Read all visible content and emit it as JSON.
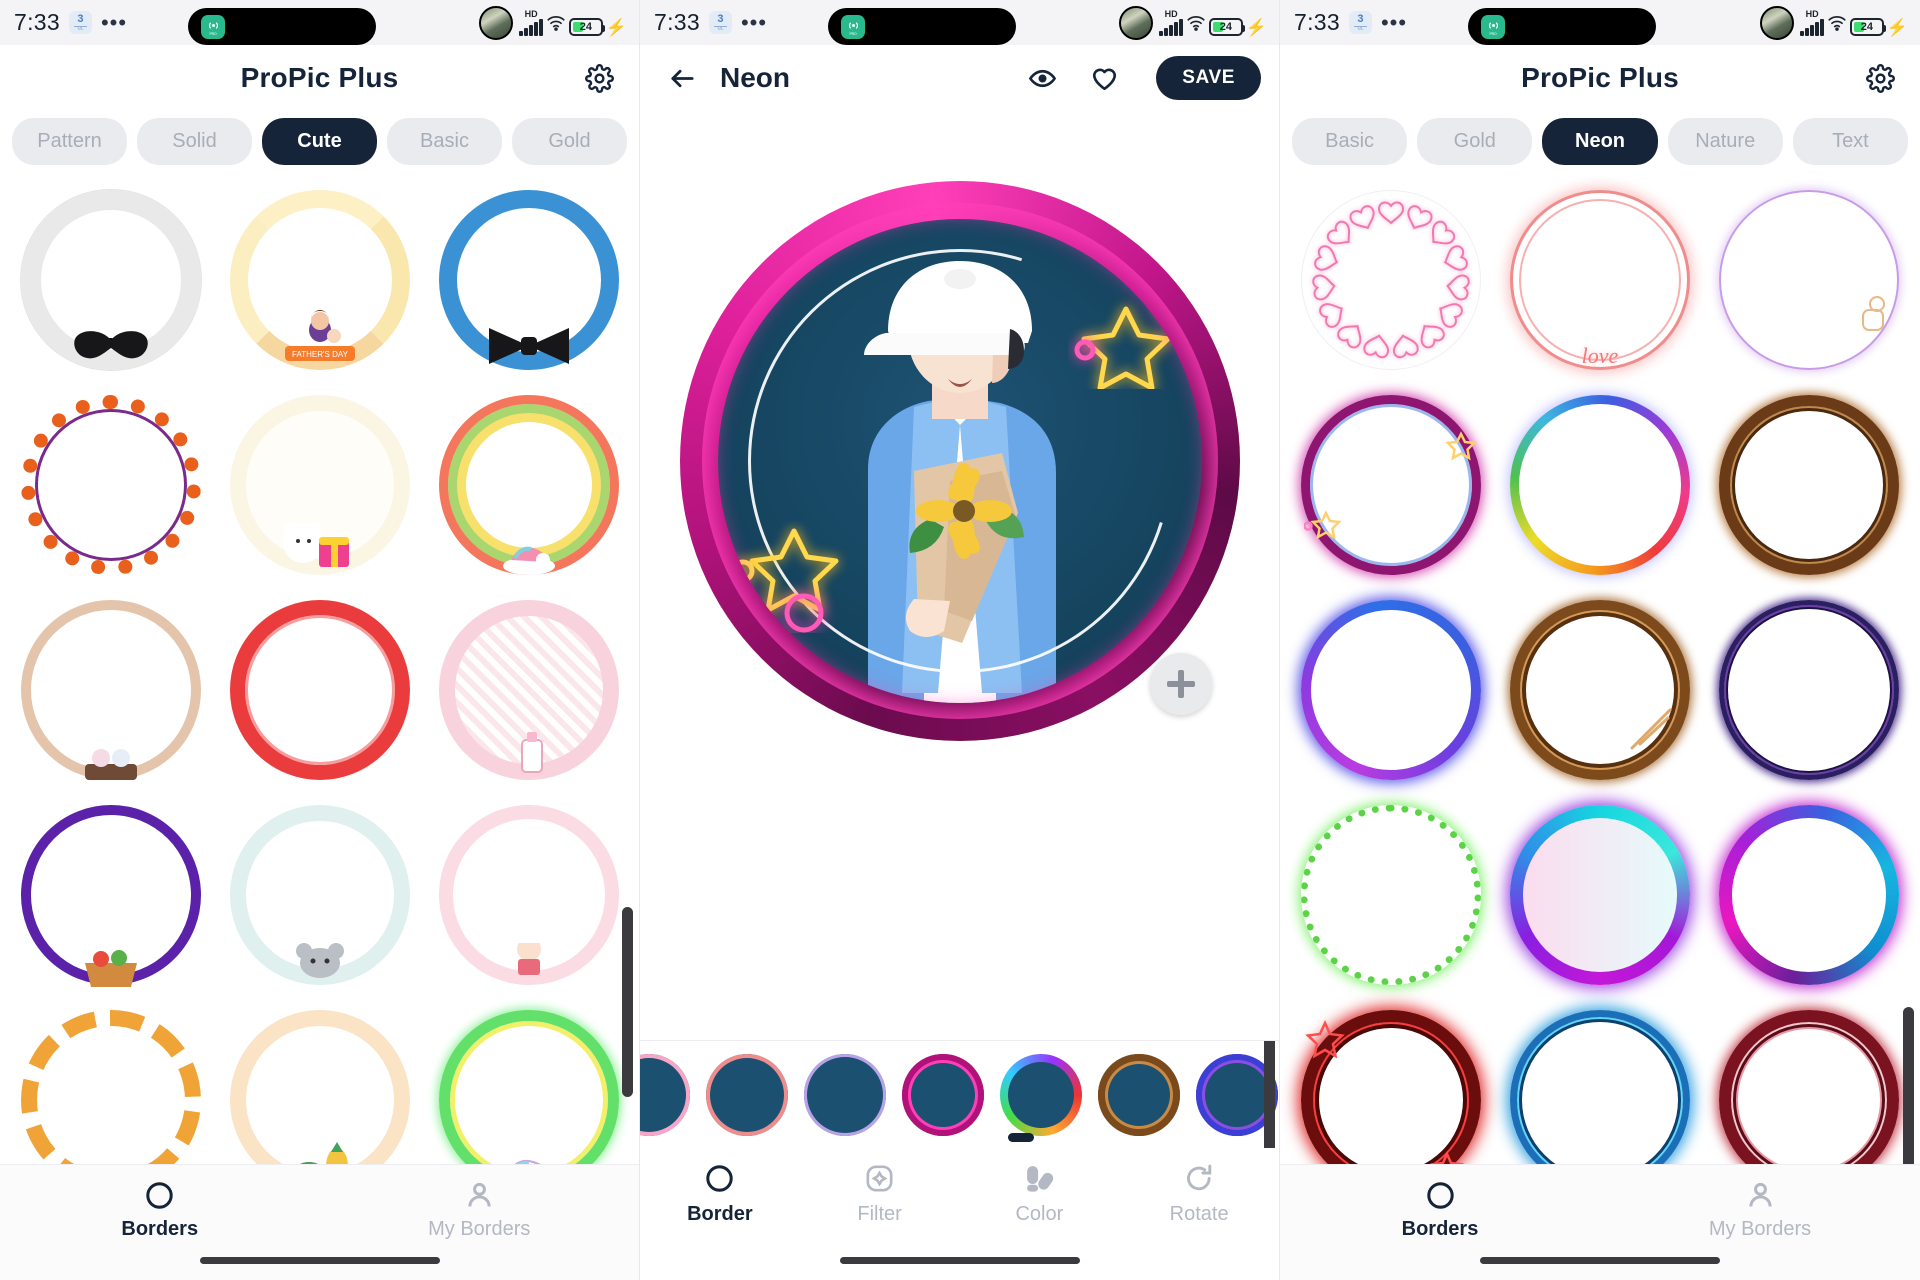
{
  "status_bar": {
    "time": "7:33",
    "chip_number": "3",
    "chip_sub": "ML",
    "overflow": "•••",
    "hd_label": "HD",
    "battery_percent": "24",
    "charging_icon": "charging-bolt-icon",
    "icons": [
      "recording-pill-icon",
      "avatar-icon",
      "hd-icon",
      "signal-icon",
      "wifi-icon",
      "battery-icon"
    ]
  },
  "panel1": {
    "header": {
      "title": "ProPic Plus",
      "settings_icon": "gear-icon"
    },
    "tabs": [
      {
        "label": "Pattern",
        "active": false
      },
      {
        "label": "Solid",
        "active": false
      },
      {
        "label": "Cute",
        "active": true
      },
      {
        "label": "Basic",
        "active": false
      },
      {
        "label": "Gold",
        "active": false
      }
    ],
    "borders": [
      {
        "name": "mustache-white-ruffle-border"
      },
      {
        "name": "fathers-day-cream-border"
      },
      {
        "name": "bowtie-blue-border"
      },
      {
        "name": "candy-orange-border"
      },
      {
        "name": "bear-gift-cream-border"
      },
      {
        "name": "unicorn-rainbow-border"
      },
      {
        "name": "teacup-beige-border"
      },
      {
        "name": "strawberry-red-border"
      },
      {
        "name": "pink-gingham-bottle-border"
      },
      {
        "name": "purple-picnic-basket-border"
      },
      {
        "name": "koala-mint-border"
      },
      {
        "name": "pink-chef-border"
      },
      {
        "name": "tiger-orange-border"
      },
      {
        "name": "watermelon-pineapple-border"
      },
      {
        "name": "unicorn-cloud-neon-border"
      }
    ],
    "bottom_nav": [
      {
        "label": "Borders",
        "icon": "circle-icon",
        "active": true
      },
      {
        "label": "My Borders",
        "icon": "person-icon",
        "active": false
      }
    ]
  },
  "panel2": {
    "header": {
      "back_icon": "back-arrow-icon",
      "title": "Neon",
      "preview_icon": "eye-icon",
      "favorite_icon": "heart-icon",
      "save_label": "SAVE"
    },
    "canvas": {
      "add_sticker_icon": "plus-icon",
      "border_name": "neon-magenta-ring",
      "subject": "person-with-sunflower-bouquet"
    },
    "thumbnails": [
      {
        "name": "thumb-heart-pink"
      },
      {
        "name": "thumb-coral-neon"
      },
      {
        "name": "thumb-lavender-thin"
      },
      {
        "name": "thumb-magenta-stars",
        "selected": true
      },
      {
        "name": "thumb-rainbow"
      },
      {
        "name": "thumb-brown-rope"
      },
      {
        "name": "thumb-blue-violet"
      }
    ],
    "toolbar": [
      {
        "label": "Border",
        "icon": "circle-icon",
        "active": true
      },
      {
        "label": "Filter",
        "icon": "filter-sparkle-icon",
        "active": false
      },
      {
        "label": "Color",
        "icon": "color-palette-icon",
        "active": false
      },
      {
        "label": "Rotate",
        "icon": "rotate-cw-icon",
        "active": false
      }
    ]
  },
  "panel3": {
    "header": {
      "title": "ProPic Plus",
      "settings_icon": "gear-icon"
    },
    "tabs": [
      {
        "label": "Basic",
        "active": false
      },
      {
        "label": "Gold",
        "active": false
      },
      {
        "label": "Neon",
        "active": true
      },
      {
        "label": "Nature",
        "active": false
      },
      {
        "label": "Text",
        "active": false
      }
    ],
    "borders": [
      {
        "name": "neon-pink-hearts-border"
      },
      {
        "name": "neon-coral-love-border",
        "text": "love"
      },
      {
        "name": "neon-lavender-lock-border"
      },
      {
        "name": "neon-magenta-stars-border"
      },
      {
        "name": "neon-rainbow-border"
      },
      {
        "name": "neon-brown-rope-border"
      },
      {
        "name": "neon-blue-violet-border"
      },
      {
        "name": "neon-copper-arrow-border"
      },
      {
        "name": "neon-indigo-thin-border"
      },
      {
        "name": "neon-green-bulbs-border"
      },
      {
        "name": "neon-purple-cyan-glass-border"
      },
      {
        "name": "neon-magenta-cyan-border"
      },
      {
        "name": "neon-red-stars-border"
      },
      {
        "name": "neon-blue-ring-border"
      },
      {
        "name": "neon-crimson-double-border"
      }
    ],
    "bottom_nav": [
      {
        "label": "Borders",
        "icon": "circle-icon",
        "active": true
      },
      {
        "label": "My Borders",
        "icon": "person-icon",
        "active": false
      }
    ]
  },
  "colors": {
    "accent_dark": "#16243a",
    "chip_bg": "#e9ebef",
    "chip_text": "#a8aeb8",
    "battery_green": "#3ddc6e",
    "neon_magenta": "#e0219d"
  }
}
